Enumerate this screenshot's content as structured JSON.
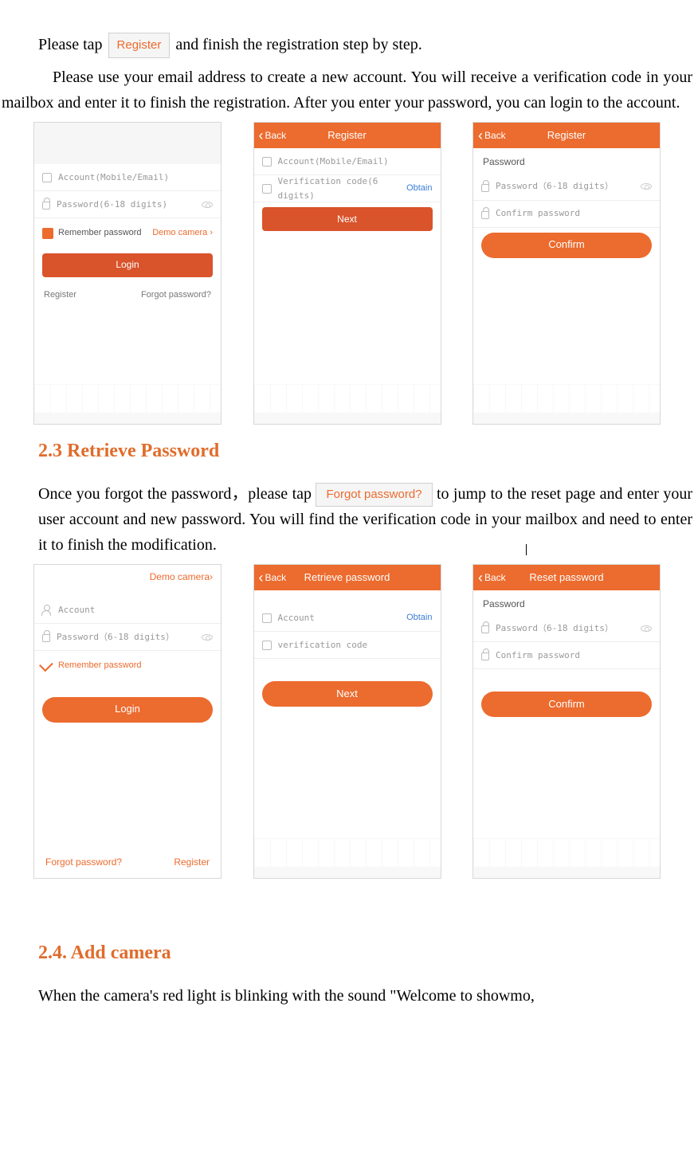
{
  "intro": {
    "line1_a": "Please tap",
    "chip_register": "Register",
    "line1_b": "and finish the registration step by step.",
    "para2": "Please use your email address to create a new account. You will receive a verification code in your mailbox and enter it to finish the registration. After you enter your password, you can login to the account."
  },
  "shots1": {
    "s1": {
      "account_ph": "Account(Mobile/Email)",
      "password_ph": "Password(6-18 digits)",
      "remember": "Remember password",
      "demo": "Demo camera",
      "login": "Login",
      "register": "Register",
      "forgot": "Forgot password?"
    },
    "s2": {
      "back": "Back",
      "title": "Register",
      "account_ph": "Account(Mobile/Email)",
      "code_ph": "Verification code(6 digits)",
      "obtain": "Obtain",
      "next": "Next"
    },
    "s3": {
      "back": "Back",
      "title": "Register",
      "section": "Password",
      "p1": "Password（6-18 digits）",
      "p2": "Confirm password",
      "confirm": "Confirm"
    }
  },
  "heading1": "2.3 Retrieve Password",
  "retrieve": {
    "line_a": "Once you forgot the password，please tap",
    "chip_forgot_img": "Forgot password?",
    "line_b": "to jump to the reset page and enter your user account and new password. You will find the verification code in your mailbox and need to enter it to finish the modification."
  },
  "shots2": {
    "s1": {
      "demo": "Demo camera",
      "account": "Account",
      "password_ph": "Password（6-18 digits）",
      "remember": "Remember password",
      "login": "Login",
      "forgot": "Forgot password?",
      "register": "Register"
    },
    "s2": {
      "back": "Back",
      "title": "Retrieve password",
      "account": "Account",
      "obtain": "Obtain",
      "code": "verification code",
      "next": "Next"
    },
    "s3": {
      "back": "Back",
      "title": "Reset password",
      "section": "Password",
      "p1": "Password（6-18 digits）",
      "p2": "Confirm password",
      "confirm": "Confirm"
    }
  },
  "heading2": "2.4. Add camera",
  "addcam": {
    "para": "When the camera's red light is blinking with the sound \"Welcome to showmo,"
  }
}
